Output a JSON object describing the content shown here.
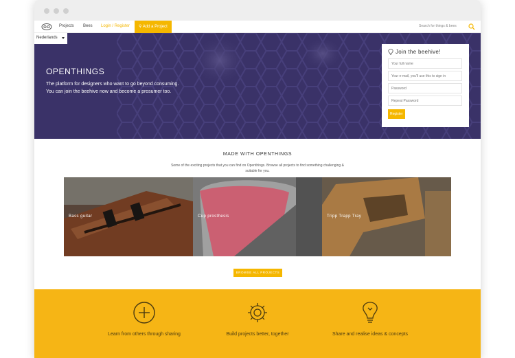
{
  "navbar": {
    "links": [
      "Projects",
      "Bees"
    ],
    "login": "Login / Register",
    "add_project": "Add a Project",
    "search_placeholder": "Search for things & bees"
  },
  "hero": {
    "language": "Nederlands",
    "title": "OPENTHINGS",
    "text_line1": "The platform for designers who want to go beyond consuming.",
    "text_line2": "You can join the beehive now and become a prosumer too."
  },
  "signup": {
    "title": "Join the beehive!",
    "name_placeholder": "Your full name",
    "email_placeholder": "Your e-mail, you'll use this to sign in",
    "password_placeholder": "Password",
    "repeat_placeholder": "Repeat Password",
    "button": "Register"
  },
  "made_with": {
    "title": "MADE WITH OPENTHINGS",
    "text": "Some of the exciting projects that you can find on Openthings. Browse all projects to find something challenging & suitable for you."
  },
  "projects": [
    "Bass guitar",
    "Cup prosthesis",
    "Tripp Trapp Tray"
  ],
  "browse_button": "BROWSE ALL PROJECTS",
  "features": [
    {
      "icon": "plus-circle-icon",
      "text": "Learn from others through sharing"
    },
    {
      "icon": "gear-icon",
      "text": "Build projects better, together"
    },
    {
      "icon": "lightbulb-icon",
      "text": "Share and realise ideas & concepts"
    }
  ],
  "colors": {
    "accent": "#f5b700",
    "hero_bg": "#3a3268",
    "features_bg": "#f6b515"
  }
}
